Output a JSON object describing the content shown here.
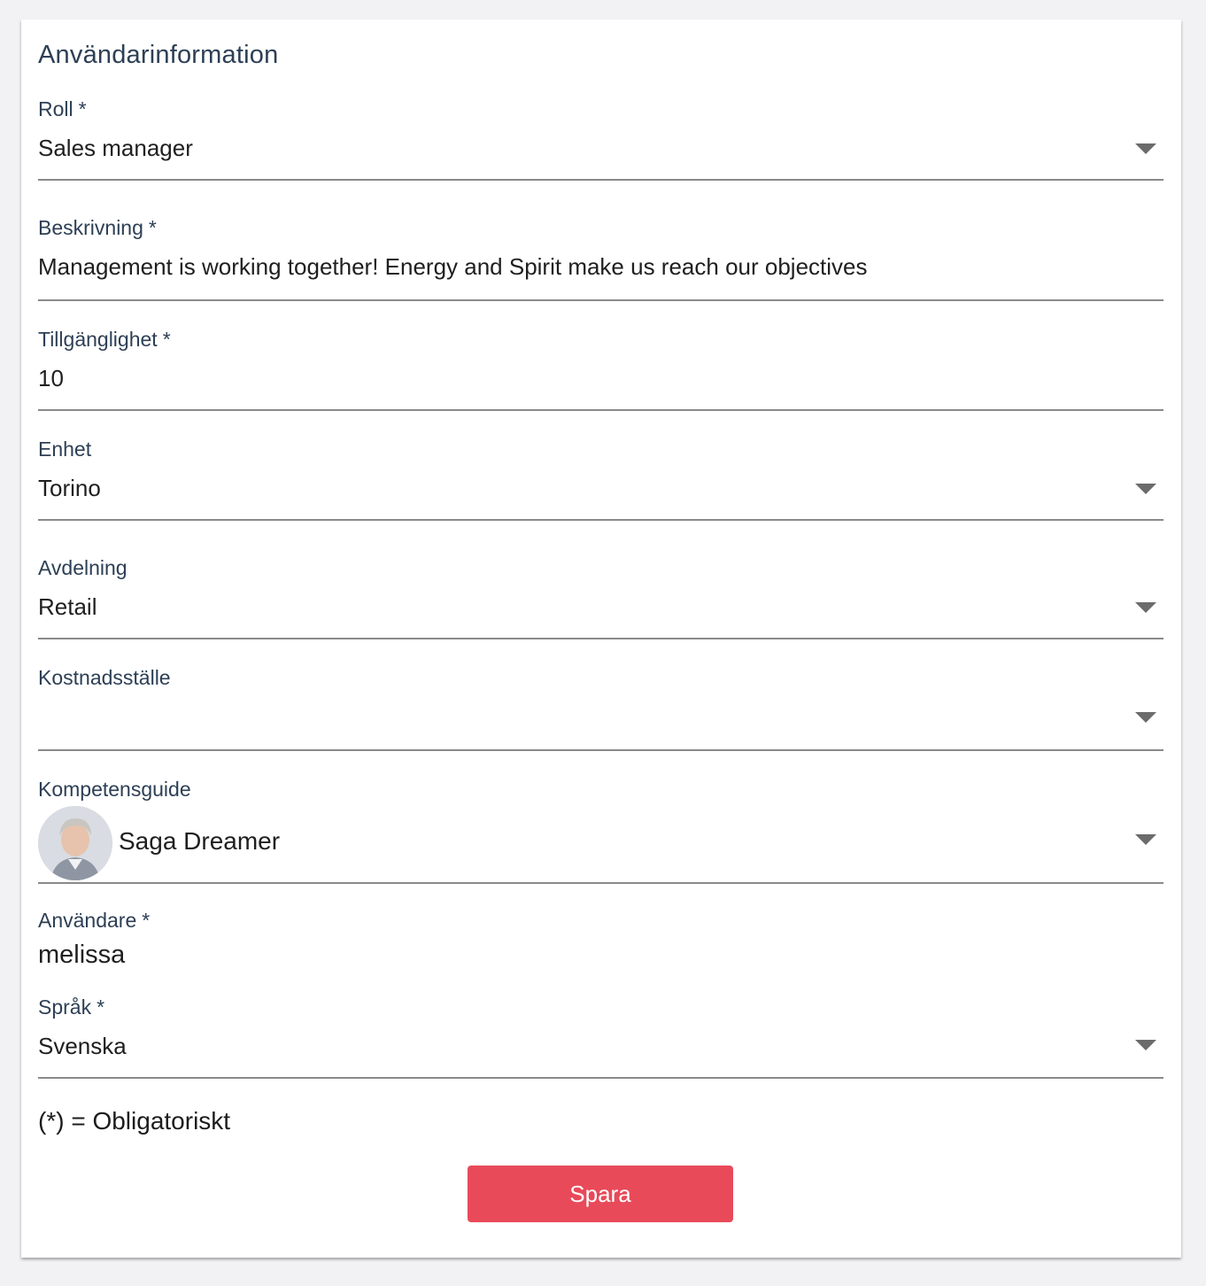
{
  "title": "Användarinformation",
  "fields": [
    {
      "label": "Roll",
      "required": "*",
      "value": "Sales manager"
    },
    {
      "label": "Beskrivning",
      "required": "*",
      "value": "Management is working together! Energy and Spirit make us reach our objectives"
    },
    {
      "label": "Tillgänglighet",
      "required": "*",
      "value": "10"
    },
    {
      "label": "Enhet",
      "value": "Torino"
    },
    {
      "label": "Avdelning",
      "value": "Retail"
    },
    {
      "label": "Kostnadsställe",
      "value": ""
    },
    {
      "label": "Kompetensguide",
      "value": "Saga Dreamer"
    },
    {
      "label": "Användare",
      "required": "*",
      "value": "melissa"
    },
    {
      "label": "Språk",
      "required": "*",
      "value": "Svenska"
    }
  ],
  "required_note": "(*) = Obligatoriskt",
  "save_label": "Spara",
  "colors": {
    "accent": "#e84a59",
    "label": "#2d3f55",
    "underline": "#8a8a8a"
  },
  "icons": {
    "dropdown": "chevron-down-icon",
    "avatar": "person-avatar"
  }
}
